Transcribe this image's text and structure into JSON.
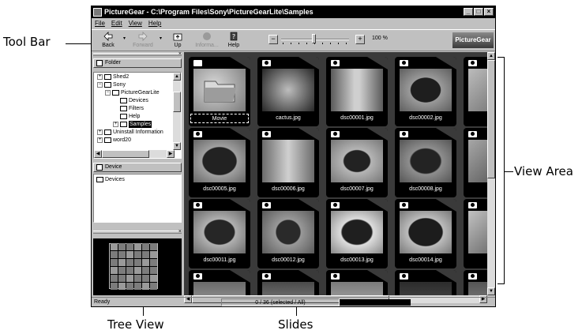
{
  "window": {
    "title": "PictureGear - C:\\Program Files\\Sony\\PictureGearLite\\Samples",
    "minimize": "_",
    "maximize": "□",
    "close": "×"
  },
  "menu": [
    "File",
    "Edit",
    "View",
    "Help"
  ],
  "toolbar": {
    "back": "Back",
    "forward": "Forward",
    "up": "Up",
    "information": "Informa...",
    "help": "Help",
    "zoom_out": "−",
    "zoom_in": "+",
    "zoom_value": "100",
    "zoom_unit": "%",
    "zoom_level_percent": 48,
    "brand": "PictureGear"
  },
  "folder_pane": {
    "header": "Folder",
    "close": "×",
    "nodes": [
      {
        "label": "Shed2",
        "expander": "+"
      },
      {
        "label": "Sony",
        "expander": "−"
      },
      {
        "label": "PictureGearLite",
        "expander": "−"
      },
      {
        "label": "Devices",
        "expander": ""
      },
      {
        "label": "Filters",
        "expander": ""
      },
      {
        "label": "Help",
        "expander": ""
      },
      {
        "label": "Samples",
        "expander": "+",
        "selected": true
      },
      {
        "label": "Uninstall Information",
        "expander": "+"
      },
      {
        "label": "word20",
        "expander": "+"
      }
    ]
  },
  "device_pane": {
    "header": "Device",
    "items": [
      "Devices"
    ]
  },
  "navigator": {
    "close": "×"
  },
  "slides": [
    {
      "caption": "Movie",
      "kind": "folder",
      "selected": true
    },
    {
      "caption": "cactus.jpg",
      "kind": "photo"
    },
    {
      "caption": "dsc00001.jpg",
      "kind": "photo"
    },
    {
      "caption": "dsc00002.jpg",
      "kind": "photo"
    },
    {
      "caption": "dsc",
      "kind": "photo"
    },
    {
      "caption": "dsc00005.jpg",
      "kind": "photo"
    },
    {
      "caption": "dsc00006.jpg",
      "kind": "photo"
    },
    {
      "caption": "dsc00007.jpg",
      "kind": "photo"
    },
    {
      "caption": "dsc00008.jpg",
      "kind": "photo"
    },
    {
      "caption": "dsc",
      "kind": "photo"
    },
    {
      "caption": "dsc00011.jpg",
      "kind": "photo"
    },
    {
      "caption": "dsc00012.jpg",
      "kind": "photo"
    },
    {
      "caption": "dsc00013.jpg",
      "kind": "photo"
    },
    {
      "caption": "dsc00014.jpg",
      "kind": "photo"
    },
    {
      "caption": "dsc",
      "kind": "photo"
    },
    {
      "caption": "",
      "kind": "photo"
    },
    {
      "caption": "",
      "kind": "photo"
    },
    {
      "caption": "",
      "kind": "photo"
    },
    {
      "caption": "",
      "kind": "photo"
    },
    {
      "caption": "",
      "kind": "photo"
    }
  ],
  "status": {
    "ready": "Ready",
    "count": "0 / 36 (selected / All)"
  },
  "callouts": {
    "toolbar": "Tool Bar",
    "view_area": "View Area",
    "tree_view": "Tree View",
    "slides": "Slides"
  }
}
